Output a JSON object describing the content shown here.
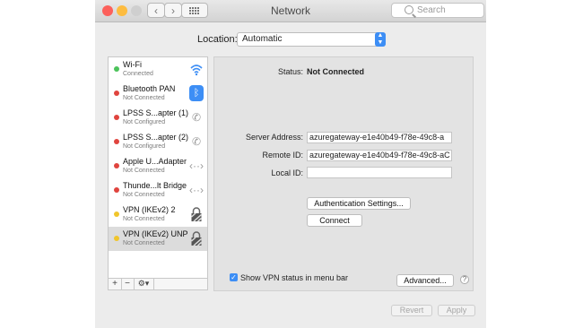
{
  "window": {
    "title": "Network"
  },
  "search": {
    "placeholder": "Search"
  },
  "location": {
    "label": "Location:",
    "value": "Automatic"
  },
  "sidebar": {
    "items": [
      {
        "name": "Wi-Fi",
        "status": "Connected",
        "dot": "#4cc35b",
        "icon": "wifi-icon"
      },
      {
        "name": "Bluetooth PAN",
        "status": "Not Connected",
        "dot": "#e0443e",
        "icon": "bluetooth-icon"
      },
      {
        "name": "LPSS S...apter (1)",
        "status": "Not Configured",
        "dot": "#e0443e",
        "icon": "phone-icon"
      },
      {
        "name": "LPSS S...apter (2)",
        "status": "Not Configured",
        "dot": "#e0443e",
        "icon": "phone-icon"
      },
      {
        "name": "Apple U...Adapter",
        "status": "Not Connected",
        "dot": "#e0443e",
        "icon": "ethernet-icon"
      },
      {
        "name": "Thunde...lt Bridge",
        "status": "Not Connected",
        "dot": "#e0443e",
        "icon": "ethernet-icon"
      },
      {
        "name": "VPN (IKEv2) 2",
        "status": "Not Connected",
        "dot": "#f0c52b",
        "icon": "lock-icon"
      },
      {
        "name": "VPN (IKEv2) UNP",
        "status": "Not Connected",
        "dot": "#f0c52b",
        "icon": "lock-icon"
      }
    ],
    "add": "+",
    "remove": "−",
    "gear": "⚙▾"
  },
  "detail": {
    "status_label": "Status:",
    "status_value": "Not Connected",
    "server_label": "Server Address:",
    "server_value": "azuregateway-e1e40b49-f78e-49c8-a",
    "remote_label": "Remote ID:",
    "remote_value": "azuregateway-e1e40b49-f78e-49c8-aC",
    "local_label": "Local ID:",
    "local_value": "",
    "auth_button": "Authentication Settings...",
    "connect_button": "Connect",
    "show_vpn_label": "Show VPN status in menu bar",
    "advanced_button": "Advanced...",
    "help": "?"
  },
  "footer": {
    "revert": "Revert",
    "apply": "Apply"
  },
  "colors": {
    "accent": "#3d8ef5",
    "close": "#fc605b",
    "min": "#fdbc40",
    "zoom": "#d5d5d5"
  }
}
